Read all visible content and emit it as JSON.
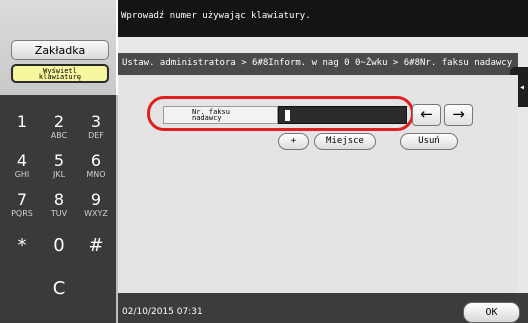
{
  "left_panel": {
    "bookmark_label": "Zakładka",
    "show_keyboard_line1": "Wyświetl",
    "show_keyboard_line2": "klawiaturę"
  },
  "keypad": {
    "keys": [
      {
        "digit": "1",
        "letters": ""
      },
      {
        "digit": "2",
        "letters": "ABC"
      },
      {
        "digit": "3",
        "letters": "DEF"
      },
      {
        "digit": "4",
        "letters": "GHI"
      },
      {
        "digit": "5",
        "letters": "JKL"
      },
      {
        "digit": "6",
        "letters": "MNO"
      },
      {
        "digit": "7",
        "letters": "PQRS"
      },
      {
        "digit": "8",
        "letters": "TUV"
      },
      {
        "digit": "9",
        "letters": "WXYZ"
      },
      {
        "digit": "*",
        "letters": ""
      },
      {
        "digit": "0",
        "letters": ""
      },
      {
        "digit": "#",
        "letters": ""
      }
    ],
    "clear_label": "C"
  },
  "message": "Wprowadź numer używając klawiatury.",
  "breadcrumb": "Ustaw. administratora > 6#8Inform. w nag 0 0~Żwku > 6#8Nr. faksu nadawcy",
  "side_tab_glyph": "◂◂",
  "field": {
    "label_line1": "Nr. faksu",
    "label_line2": "nadawcy",
    "value": ""
  },
  "buttons": {
    "left_arrow": "←",
    "right_arrow": "→",
    "plus": "+",
    "space": "Miejsce",
    "delete": "Usuń",
    "ok": "OK"
  },
  "status": {
    "datetime": "02/10/2015  07:31"
  },
  "colors": {
    "highlight": "#e02020",
    "accent_yellow": "#f7f7a0"
  }
}
